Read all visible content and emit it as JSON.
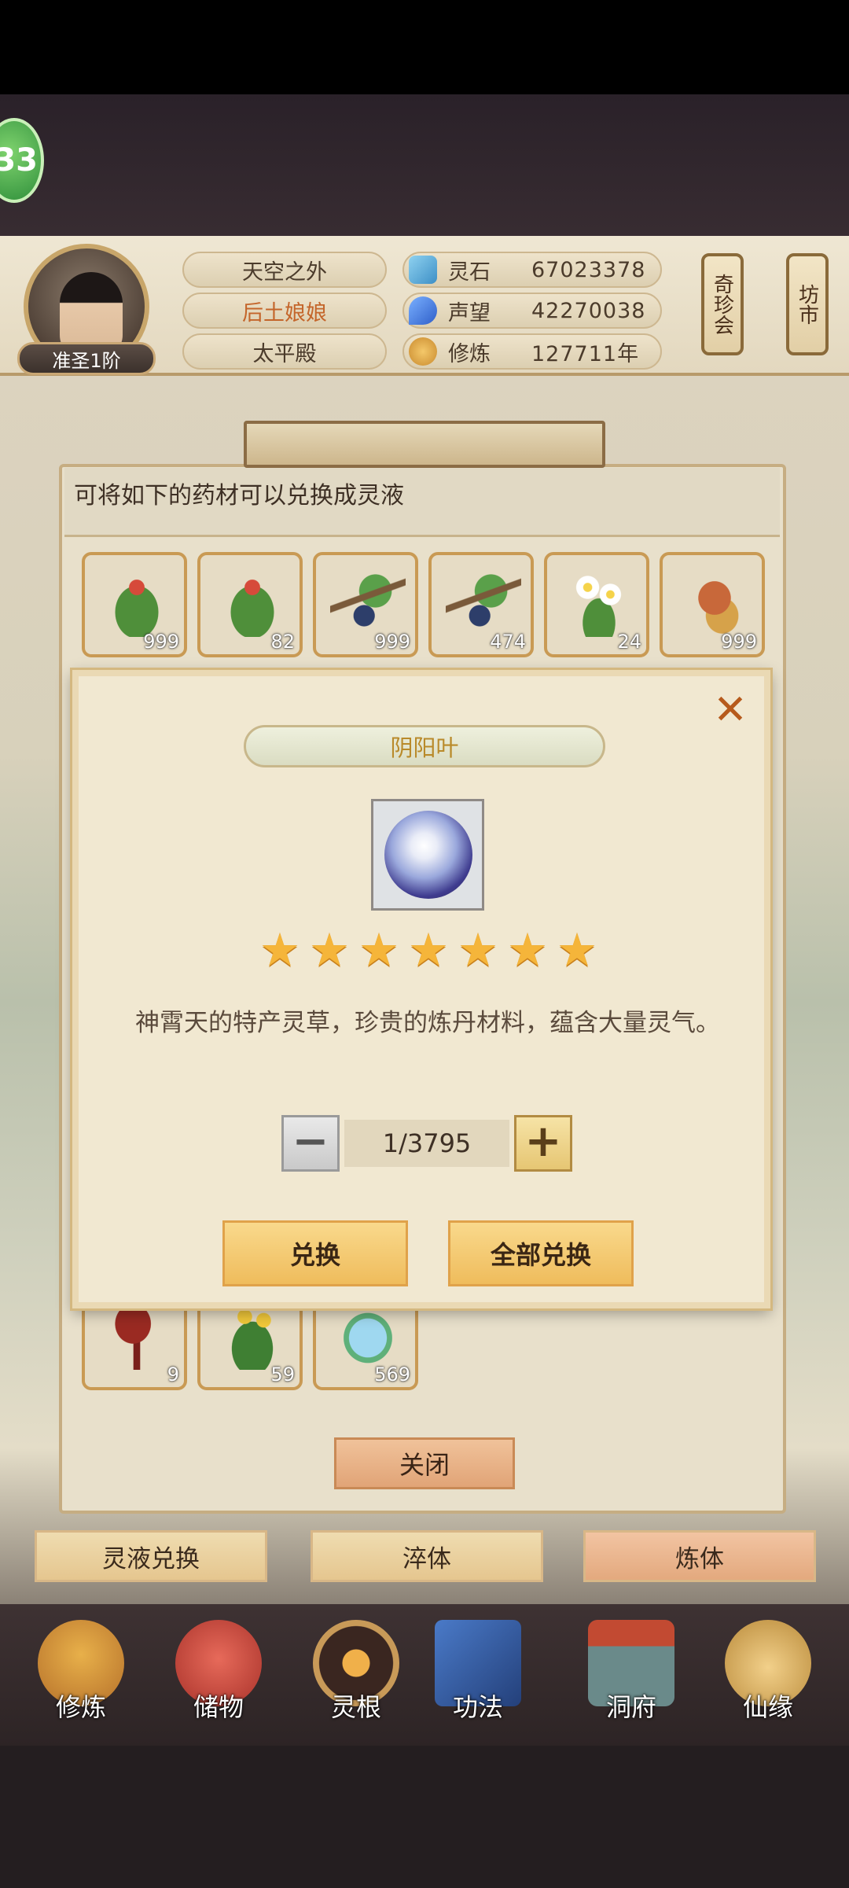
{
  "status": {
    "level": "33"
  },
  "header": {
    "rank": "准圣1阶",
    "titles": [
      "天空之外",
      "后土娘娘",
      "太平殿"
    ],
    "stats": [
      {
        "label": "灵石",
        "value": "67023378",
        "icon": "spirit-stone-icon"
      },
      {
        "label": "声望",
        "value": "42270038",
        "icon": "reputation-icon"
      },
      {
        "label": "修炼",
        "value": "127711年",
        "icon": "cultivation-icon"
      }
    ],
    "scroll_buttons": [
      "奇珍会",
      "坊市"
    ]
  },
  "panel": {
    "description": "可将如下的药材可以兑换成灵液",
    "items_top": [
      {
        "count": "999",
        "icon": "herb-red-flower-icon"
      },
      {
        "count": "82",
        "icon": "herb-red-flower-icon"
      },
      {
        "count": "999",
        "icon": "blue-berry-branch-icon"
      },
      {
        "count": "474",
        "icon": "blue-berry-branch-icon"
      },
      {
        "count": "24",
        "icon": "white-daisy-icon"
      },
      {
        "count": "999",
        "icon": "ginseng-root-icon"
      }
    ],
    "items_bottom": [
      {
        "count": "9",
        "icon": "red-mushroom-icon"
      },
      {
        "count": "59",
        "icon": "yellow-flower-herb-icon"
      },
      {
        "count": "569",
        "icon": "blue-grass-icon"
      }
    ],
    "close_label": "关闭"
  },
  "tabs": [
    "灵液兑换",
    "淬体",
    "炼体"
  ],
  "nav": [
    {
      "label": "修炼",
      "icon": "cultivate-icon"
    },
    {
      "label": "储物",
      "icon": "storage-bag-icon"
    },
    {
      "label": "灵根",
      "icon": "spirit-root-icon"
    },
    {
      "label": "功法",
      "icon": "skill-book-icon"
    },
    {
      "label": "洞府",
      "icon": "cave-palace-icon"
    },
    {
      "label": "仙缘",
      "icon": "immortal-fate-icon"
    }
  ],
  "modal": {
    "title": "阴阳叶",
    "item_icon": "yin-yang-leaf-icon",
    "stars": 7,
    "description": "神霄天的特产灵草，珍贵的炼丹材料，蕴含大量灵气。",
    "quantity": "1/3795",
    "exchange_label": "兑换",
    "exchange_all_label": "全部兑换"
  }
}
